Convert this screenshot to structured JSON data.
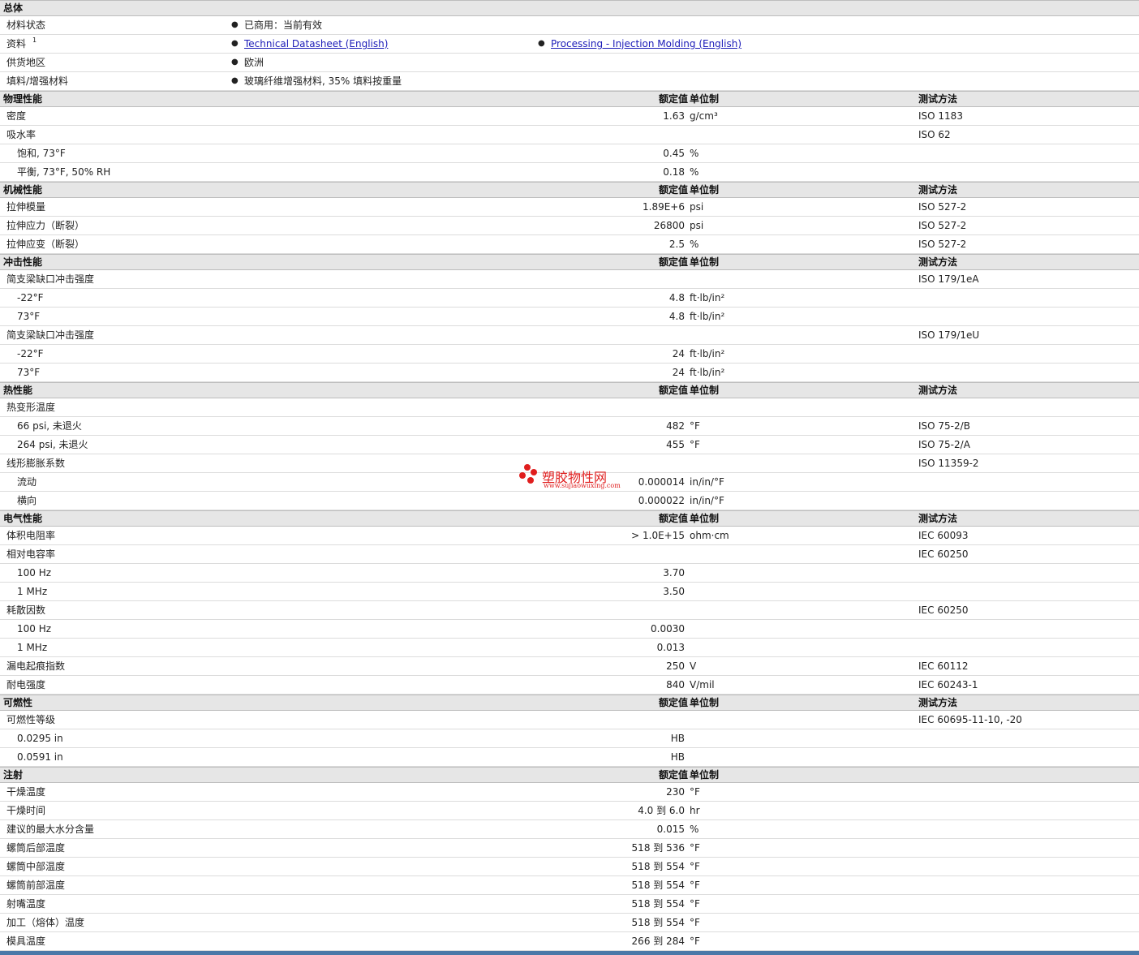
{
  "sections": [
    {
      "kind": "general",
      "title": "总体",
      "rows": [
        {
          "name": "材料状态",
          "items": [
            "已商用：当前有效"
          ]
        },
        {
          "name": "资料",
          "note": "1",
          "links": [
            "Technical Datasheet (English)",
            "Processing - Injection Molding (English)"
          ]
        },
        {
          "name": "供货地区",
          "items": [
            "欧洲"
          ]
        },
        {
          "name": "填料/增强材料",
          "items": [
            "玻璃纤维增强材料, 35% 填料按重量"
          ]
        }
      ]
    },
    {
      "title": "物理性能",
      "col_value": "额定值",
      "col_unit": "单位制",
      "col_method": "测试方法",
      "rows": [
        {
          "name": "密度",
          "value": "1.63",
          "unit": "g/cm³",
          "method": "ISO 1183"
        },
        {
          "name": "吸水率",
          "value": "",
          "unit": "",
          "method": "ISO 62"
        },
        {
          "name": "饱和, 73°F",
          "indent": true,
          "value": "0.45",
          "unit": "%",
          "method": ""
        },
        {
          "name": "平衡, 73°F, 50% RH",
          "indent": true,
          "value": "0.18",
          "unit": "%",
          "method": ""
        }
      ]
    },
    {
      "title": "机械性能",
      "col_value": "额定值",
      "col_unit": "单位制",
      "col_method": "测试方法",
      "rows": [
        {
          "name": "拉伸模量",
          "value": "1.89E+6",
          "unit": "psi",
          "method": "ISO 527-2"
        },
        {
          "name": "拉伸应力（断裂）",
          "value": "26800",
          "unit": "psi",
          "method": "ISO 527-2"
        },
        {
          "name": "拉伸应变（断裂）",
          "value": "2.5",
          "unit": "%",
          "method": "ISO 527-2"
        }
      ]
    },
    {
      "title": "冲击性能",
      "col_value": "额定值",
      "col_unit": "单位制",
      "col_method": "测试方法",
      "rows": [
        {
          "name": "简支梁缺口冲击强度",
          "value": "",
          "unit": "",
          "method": "ISO 179/1eA"
        },
        {
          "name": "-22°F",
          "indent": true,
          "value": "4.8",
          "unit": "ft·lb/in²",
          "method": ""
        },
        {
          "name": "73°F",
          "indent": true,
          "value": "4.8",
          "unit": "ft·lb/in²",
          "method": ""
        },
        {
          "name": "简支梁缺口冲击强度",
          "value": "",
          "unit": "",
          "method": "ISO 179/1eU"
        },
        {
          "name": "-22°F",
          "indent": true,
          "value": "24",
          "unit": "ft·lb/in²",
          "method": ""
        },
        {
          "name": "73°F",
          "indent": true,
          "value": "24",
          "unit": "ft·lb/in²",
          "method": ""
        }
      ]
    },
    {
      "title": "热性能",
      "col_value": "额定值",
      "col_unit": "单位制",
      "col_method": "测试方法",
      "rows": [
        {
          "name": "热变形温度",
          "value": "",
          "unit": "",
          "method": ""
        },
        {
          "name": "66 psi, 未退火",
          "indent": true,
          "value": "482",
          "unit": "°F",
          "method": "ISO 75-2/B"
        },
        {
          "name": "264 psi, 未退火",
          "indent": true,
          "value": "455",
          "unit": "°F",
          "method": "ISO 75-2/A"
        },
        {
          "name": "线形膨胀系数",
          "value": "",
          "unit": "",
          "method": "ISO 11359-2"
        },
        {
          "name": "流动",
          "indent": true,
          "value": "0.000014",
          "unit": "in/in/°F",
          "method": ""
        },
        {
          "name": "横向",
          "indent": true,
          "value": "0.000022",
          "unit": "in/in/°F",
          "method": ""
        }
      ]
    },
    {
      "title": "电气性能",
      "col_value": "额定值",
      "col_unit": "单位制",
      "col_method": "测试方法",
      "rows": [
        {
          "name": "体积电阻率",
          "value": "> 1.0E+15",
          "unit": "ohm·cm",
          "method": "IEC 60093"
        },
        {
          "name": "相对电容率",
          "value": "",
          "unit": "",
          "method": "IEC 60250"
        },
        {
          "name": "100 Hz",
          "indent": true,
          "value": "3.70",
          "unit": "",
          "method": ""
        },
        {
          "name": "1 MHz",
          "indent": true,
          "value": "3.50",
          "unit": "",
          "method": ""
        },
        {
          "name": "耗散因数",
          "value": "",
          "unit": "",
          "method": "IEC 60250"
        },
        {
          "name": "100 Hz",
          "indent": true,
          "value": "0.0030",
          "unit": "",
          "method": ""
        },
        {
          "name": "1 MHz",
          "indent": true,
          "value": "0.013",
          "unit": "",
          "method": ""
        },
        {
          "name": "漏电起痕指数",
          "value": "250",
          "unit": "V",
          "method": "IEC 60112"
        },
        {
          "name": "耐电强度",
          "value": "840",
          "unit": "V/mil",
          "method": "IEC 60243-1"
        }
      ]
    },
    {
      "title": "可燃性",
      "col_value": "额定值",
      "col_unit": "单位制",
      "col_method": "测试方法",
      "rows": [
        {
          "name": "可燃性等级",
          "value": "",
          "unit": "",
          "method": "IEC 60695-11-10, -20"
        },
        {
          "name": "0.0295 in",
          "indent": true,
          "value": "HB",
          "unit": "",
          "method": ""
        },
        {
          "name": "0.0591 in",
          "indent": true,
          "value": "HB",
          "unit": "",
          "method": ""
        }
      ]
    },
    {
      "title": "注射",
      "col_value": "额定值",
      "col_unit": "单位制",
      "col_method": "",
      "rows": [
        {
          "name": "干燥温度",
          "value": "230",
          "unit": "°F",
          "method": ""
        },
        {
          "name": "干燥时间",
          "value": "4.0 到  6.0",
          "unit": "hr",
          "method": ""
        },
        {
          "name": "建议的最大水分含量",
          "value": "0.015",
          "unit": "%",
          "method": ""
        },
        {
          "name": "螺筒后部温度",
          "value": "518 到  536",
          "unit": "°F",
          "method": ""
        },
        {
          "name": "螺筒中部温度",
          "value": "518 到  554",
          "unit": "°F",
          "method": ""
        },
        {
          "name": "螺筒前部温度",
          "value": "518 到  554",
          "unit": "°F",
          "method": ""
        },
        {
          "name": "射嘴温度",
          "value": "518 到  554",
          "unit": "°F",
          "method": ""
        },
        {
          "name": "加工（熔体）温度",
          "value": "518 到  554",
          "unit": "°F",
          "method": ""
        },
        {
          "name": "模具温度",
          "value": "266 到  284",
          "unit": "°F",
          "method": ""
        }
      ]
    }
  ],
  "watermark": {
    "text": "塑胶物性网",
    "url": "www.sujiaowuxing.com"
  },
  "colors": {
    "header_bg": "#e6e6e6",
    "link": "#1b1bb8",
    "watermark": "#e01e1e",
    "bottom_bar": "#4a78a8"
  }
}
